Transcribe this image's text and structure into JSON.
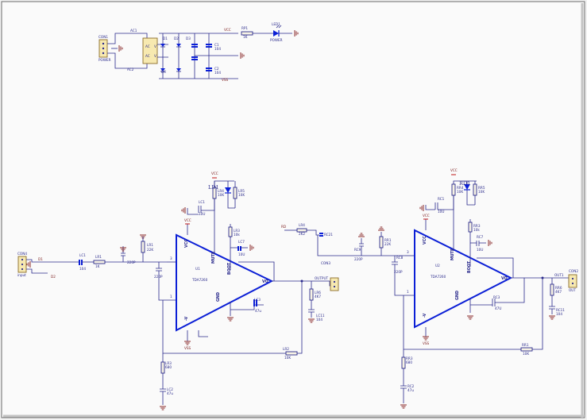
{
  "power": {
    "connector": "CON1",
    "connector_sub": "POWER",
    "ac_top": "AC1",
    "ac_bottom": "AC2",
    "diodes": [
      "D1",
      "D2",
      "D3",
      "D4"
    ],
    "caps_top": [
      "C1",
      "C2"
    ],
    "cap_values_top": [
      "104",
      "104"
    ],
    "vcc": "VCC",
    "vss": "VSS",
    "rp1": "RP1",
    "rp1_val": "1K",
    "led": "LED1",
    "led_sub": "POWER"
  },
  "ch1": {
    "in_conn": "CON4",
    "in_label": "input",
    "r1": "LR1",
    "r1_val": "1K",
    "cin": "LC1",
    "cin_val": "104",
    "ic": "TDA7260",
    "ic_ref": "U1",
    "ld": "LD1",
    "r_led": "LR4",
    "r_led_val": "10K",
    "r_led2": "LR5",
    "r_led2_val": "10K",
    "c_boot": "LC3",
    "c_boot_val": "47u",
    "out_label": "OUTPUT",
    "r_fb": "LR2",
    "r_fb_val": "10K",
    "r_gnd": "LR3",
    "r_gnd_val": "680",
    "c_gnd": "LC2",
    "c_gnd_val": "47u",
    "c_in2_val": "220P",
    "pins": {
      "vcc": "VCC",
      "mute": "MUTE",
      "boot": "BOOT",
      "gnd": "GND",
      "vo": "VO",
      "n3": "3",
      "n1": "1",
      "n14": "14"
    }
  },
  "ch2": {
    "link_label": "RD1",
    "c_link": "RC21",
    "ic": "TDA7260",
    "ic_ref": "U2",
    "rd": "RD1",
    "out_label": "OUT1",
    "out_conn": "CON2",
    "out_conn_sub": "OUT",
    "r_fb": "RR1",
    "r_fb_val": "10K",
    "r_gnd": "RR3",
    "r_gnd_val": "680",
    "c_gnd": "RC2",
    "c_gnd_val": "47u",
    "c_in_val": "220P",
    "vcc": "VCC"
  }
}
